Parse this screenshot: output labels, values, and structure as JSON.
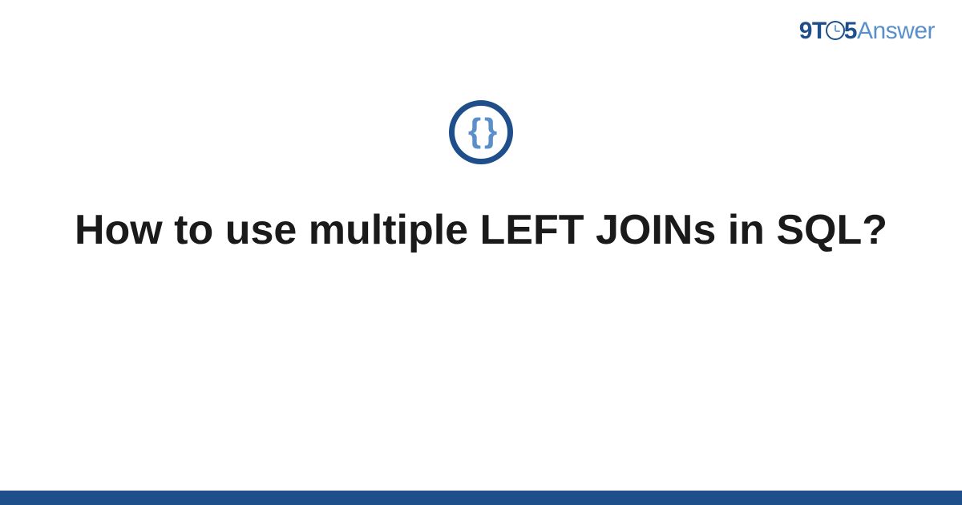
{
  "brand": {
    "part1": "9T",
    "part2": "5",
    "part3": "Answer"
  },
  "icon": {
    "name": "code-braces-icon",
    "glyph": "{ }"
  },
  "title": "How to use multiple LEFT JOINs in SQL?",
  "colors": {
    "primary": "#1e4f8a",
    "secondary": "#5a8fc9",
    "text": "#1a1a1a"
  }
}
